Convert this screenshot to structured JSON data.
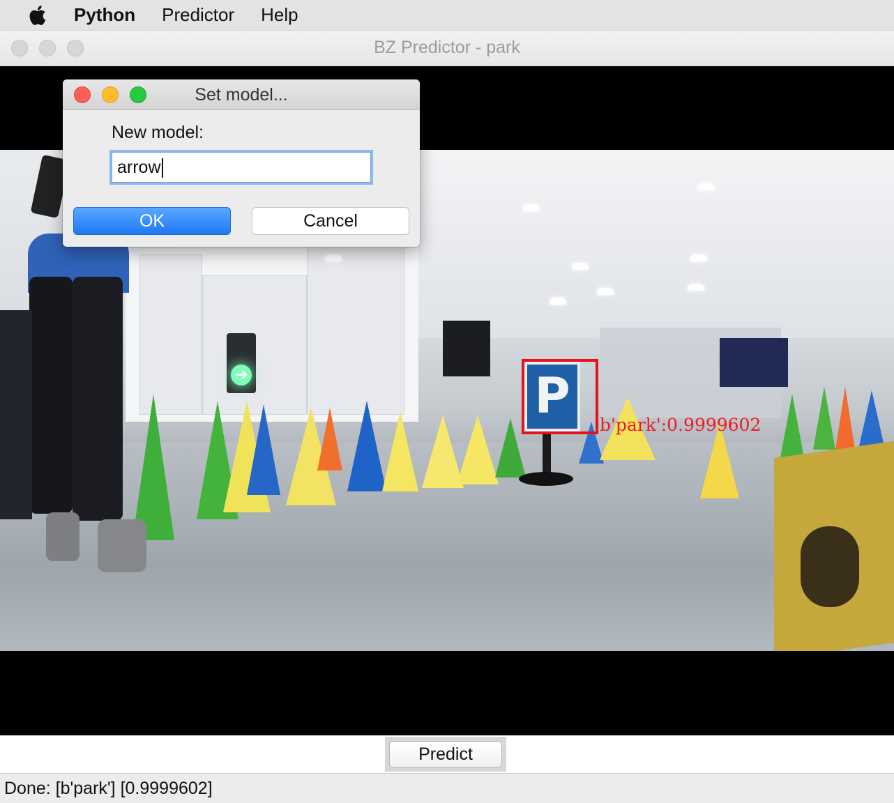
{
  "menubar": {
    "apple_icon": "apple-logo",
    "items": [
      "Python",
      "Predictor",
      "Help"
    ]
  },
  "window": {
    "title": "BZ Predictor - park"
  },
  "video": {
    "detection_label": "b'park':0.9999602",
    "sign_letter": "P",
    "box_color": "#e4141b"
  },
  "predict_button": "Predict",
  "status": "Done: [b'park'] [0.9999602]",
  "dialog": {
    "title": "Set model...",
    "field_label": "New model:",
    "field_value": "arrow",
    "ok_label": "OK",
    "cancel_label": "Cancel",
    "colors": {
      "close": "#fe5f57",
      "minimize": "#febc2e",
      "zoom": "#28c840",
      "ok": "#1f78f3"
    }
  }
}
